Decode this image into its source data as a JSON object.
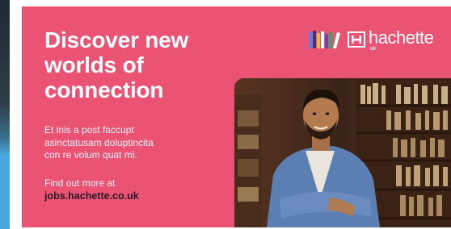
{
  "ad": {
    "headline_lines": [
      "Discover new",
      "worlds of",
      "connection"
    ],
    "body_lines": [
      "Et inis a post faccupt",
      "asinctatusam doluptincita",
      "con re volum quat mi."
    ],
    "cta_label": "Find out more at",
    "cta_link": "jobs.hachette.co.uk",
    "brand": {
      "word": "hachette",
      "sub": "UK"
    }
  },
  "colors": {
    "banner": "#ea5374",
    "link": "#2a1a22",
    "text": "#ffffff"
  },
  "icons": [
    "books-logo-icon",
    "hachette-mark-icon"
  ]
}
